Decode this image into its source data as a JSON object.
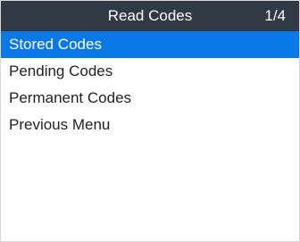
{
  "header": {
    "title": "Read Codes",
    "page_indicator": "1/4"
  },
  "menu": {
    "selected_index": 0,
    "items": [
      {
        "label": "Stored Codes"
      },
      {
        "label": "Pending Codes"
      },
      {
        "label": "Permanent Codes"
      },
      {
        "label": "Previous Menu"
      }
    ]
  },
  "colors": {
    "header_background": "#2f3a44",
    "selection_background": "#0b78e8"
  }
}
